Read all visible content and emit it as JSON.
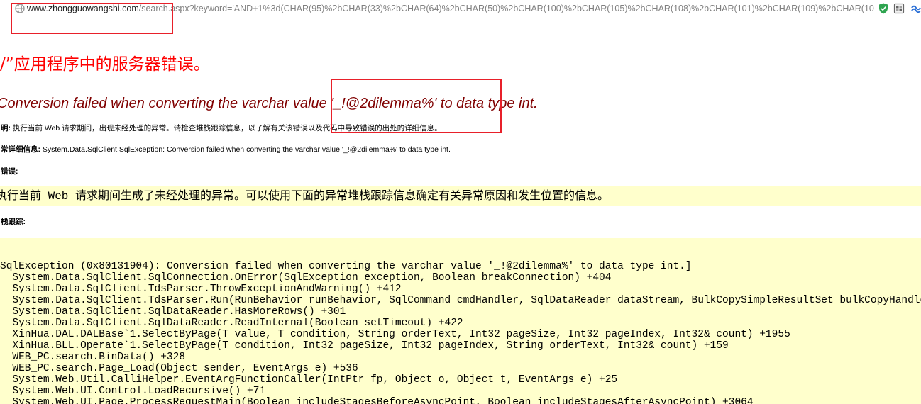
{
  "browser": {
    "address_bar": {
      "domain": "www.zhongguowangshi.com",
      "path": "/search.aspx?keyword='AND+1%3d(CHAR(95)%2bCHAR(33)%2bCHAR(64)%2bCHAR(50)%2bCHAR(100)%2bCHAR(105)%2bCHAR(108)%2bCHAR(101)%2bCHAR(109)%2bCHAR(10"
    },
    "icons": {
      "page_info": "globe-icon",
      "security": "shield-icon",
      "extension": "extension-icon",
      "extension_2": "wave-icon"
    }
  },
  "error_page": {
    "title": "/”应用程序中的服务器错误。",
    "message": "Conversion failed when converting the varchar value '_!@2dilemma%' to data type int.",
    "description": {
      "label": "明:",
      "text": "执行当前 Web 请求期间，出现未经处理的异常。请检查堆栈跟踪信息，以了解有关该错误以及代码中导致错误的出处的详细信息。"
    },
    "exception_details": {
      "label": "常详细信息:",
      "text": "System.Data.SqlClient.SqlException: Conversion failed when converting the varchar value '_!@2dilemma%' to data type int."
    },
    "source_error": {
      "label": "错误:",
      "text": "执行当前 Web 请求期间生成了未经处理的异常。可以使用下面的异常堆栈跟踪信息确定有关异常原因和发生位置的信息。"
    },
    "stack_trace": {
      "label": "栈跟踪:",
      "lines": [
        "SqlException (0x80131904): Conversion failed when converting the varchar value '_!@2dilemma%' to data type int.]",
        "System.Data.SqlClient.SqlConnection.OnError(SqlException exception, Boolean breakConnection) +404",
        "System.Data.SqlClient.TdsParser.ThrowExceptionAndWarning() +412",
        "System.Data.SqlClient.TdsParser.Run(RunBehavior runBehavior, SqlCommand cmdHandler, SqlDataReader dataStream, BulkCopySimpleResultSet bulkCopyHandle",
        "System.Data.SqlClient.SqlDataReader.HasMoreRows() +301",
        "System.Data.SqlClient.SqlDataReader.ReadInternal(Boolean setTimeout) +422",
        "XinHua.DAL.DALBase`1.SelectByPage(T value, T condition, String orderText, Int32 pageSize, Int32 pageIndex, Int32& count) +1955",
        "XinHua.BLL.Operate`1.SelectByPage(T condition, Int32 pageSize, Int32 pageIndex, String orderText, Int32& count) +159",
        "WEB_PC.search.BinData() +328",
        "WEB_PC.search.Page_Load(Object sender, EventArgs e) +536",
        "System.Web.Util.CalliHelper.EventArgFunctionCaller(IntPtr fp, Object o, Object t, EventArgs e) +25",
        "System.Web.UI.Control.LoadRecursive() +71",
        "System.Web.UI.Page.ProcessRequestMain(Boolean includeStagesBeforeAsyncPoint, Boolean includeStagesAfterAsyncPoint) +3064"
      ]
    }
  },
  "colors": {
    "title": "#ff0000",
    "message": "#800000",
    "code_background": "#ffffcc",
    "annotation": "#e8202a",
    "url_domain": "#1f1f1f",
    "url_path": "#808080"
  }
}
